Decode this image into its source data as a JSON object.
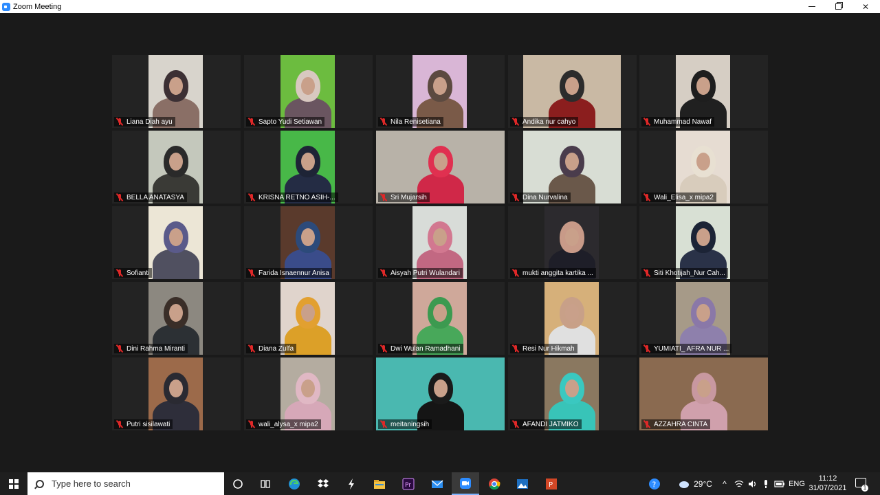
{
  "window": {
    "title": "Zoom Meeting",
    "icons": [
      "zoom-app-icon",
      "minimize-icon",
      "maximize-icon",
      "close-icon"
    ]
  },
  "participants": [
    {
      "name": "Liana Diah ayu",
      "video_bg": "#d8d4cc",
      "head": "#3c3034",
      "body": "#8a6f66"
    },
    {
      "name": "Sapto Yudi Setiawan",
      "video_bg": "#6cbc3f",
      "head": "#d8c8c0",
      "body": "#6a5560"
    },
    {
      "name": "Nila Renisetiana",
      "video_bg": "#d9b6d6",
      "head": "#5c4a40",
      "body": "#7a5a48"
    },
    {
      "name": "Andika nur cahyo",
      "video_bg": "#c9b9a4",
      "head": "#2c2c2c",
      "body": "#8b1e1e"
    },
    {
      "name": "Muhammad Nawaf",
      "video_bg": "#d6cec4",
      "head": "#1e1e1e",
      "body": "#202020"
    },
    {
      "name": "BELLA ANATASYA",
      "video_bg": "#c4c8bc",
      "head": "#2a2a2a",
      "body": "#3a3a36"
    },
    {
      "name": "KRISNA RETNO ASIH-...",
      "video_bg": "#48b848",
      "head": "#1e2436",
      "body": "#242c44"
    },
    {
      "name": "Sri Mujarsih",
      "video_bg": "#b8b2a8",
      "head": "#e03050",
      "body": "#d02848"
    },
    {
      "name": "Dina Nurvalina",
      "video_bg": "#d8ddd4",
      "head": "#4a3c4c",
      "body": "#6a584a"
    },
    {
      "name": "Wali_Elisa_x mipa2",
      "video_bg": "#e6dcd2",
      "head": "#e8e0d2",
      "body": "#d8ccbc"
    },
    {
      "name": "Sofianti",
      "video_bg": "#ece6d6",
      "head": "#5a5a8a",
      "body": "#505060"
    },
    {
      "name": "Farida Isnaennur Anisa",
      "video_bg": "#5a3a2c",
      "head": "#2c4a7a",
      "body": "#3a4c8a"
    },
    {
      "name": "Aisyah Putri Wulandari",
      "video_bg": "#d8dcd8",
      "head": "#d27890",
      "body": "#c26882"
    },
    {
      "name": "mukti anggita kartika ...",
      "video_bg": "#2c2a2e",
      "head": "#c89a88",
      "body": "#1e1e28"
    },
    {
      "name": "Siti Khotijah_Nur Cah...",
      "video_bg": "#d8e0d4",
      "head": "#1c2436",
      "body": "#2a3248"
    },
    {
      "name": "Dini Rahma Miranti",
      "video_bg": "#8c8880",
      "head": "#3a2e28",
      "body": "#2c3034"
    },
    {
      "name": "Diana Zulfa",
      "video_bg": "#e0d4cc",
      "head": "#e2a030",
      "body": "#dca028"
    },
    {
      "name": "Dwi Wulan Ramadhani",
      "video_bg": "#cfa89a",
      "head": "#3c9a50",
      "body": "#48a85a"
    },
    {
      "name": "Resi Nur Hikmah",
      "video_bg": "#d6b07a",
      "head": "#c8a088",
      "body": "#e0e0e0"
    },
    {
      "name": "YUMIATI_ AFRA NUR ...",
      "video_bg": "#a69a88",
      "head": "#8a78a8",
      "body": "#8e80ac"
    },
    {
      "name": "Putri sisilawati",
      "video_bg": "#9c6a4a",
      "head": "#2a2a32",
      "body": "#2e2e3a"
    },
    {
      "name": "wali_alysa_x mipa2",
      "video_bg": "#b4aca0",
      "head": "#e0b8c4",
      "body": "#d6a8b8"
    },
    {
      "name": "meitaningsih",
      "video_bg": "#4ab8b0",
      "head": "#1a1a1a",
      "body": "#151515"
    },
    {
      "name": "AFANDI JATMIKO",
      "video_bg": "#8a7860",
      "head": "#3ac8c0",
      "body": "#38c4b8"
    },
    {
      "name": "AZZAHRA CINTA",
      "video_bg": "#8a6a50",
      "head": "#c898a0",
      "body": "#d0a0ac"
    }
  ],
  "taskbar": {
    "search_placeholder": "Type here to search",
    "pinned": [
      "cortana-icon",
      "task-view-icon",
      "edge-icon",
      "dropbox-icon",
      "winamp-icon",
      "file-explorer-icon",
      "premiere-icon",
      "mail-icon",
      "zoom-icon",
      "chrome-icon",
      "photos-icon",
      "powerpoint-icon"
    ],
    "tray": {
      "weather_temp": "29°C",
      "language": "ENG",
      "time": "11:12",
      "date": "31/07/2021",
      "notification_count": "1"
    }
  }
}
